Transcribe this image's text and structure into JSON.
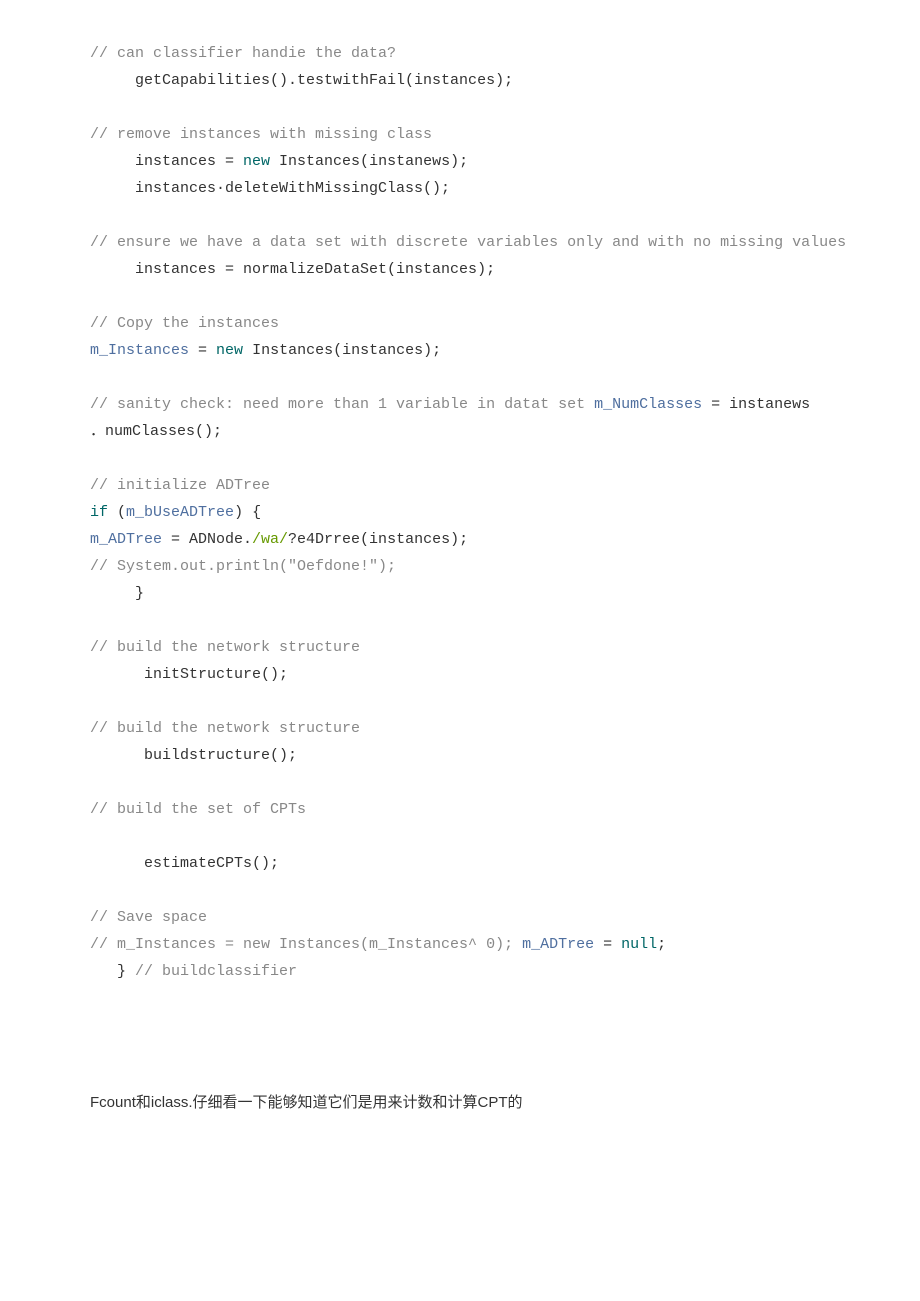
{
  "code": {
    "l1a": "// can classifier handie the data?",
    "l2a": "     getCapabilities().testwithFail(instances);",
    "l3a": "// remove instances with missing class",
    "l4a": "     instances = ",
    "l4b": "new",
    "l4c": " Instances(instanews);",
    "l5a": "     instances·deleteWithMissingClass();",
    "l6a": "// ensure we have a data set with discrete variables only and with no missing values",
    "l7a": "     instances = normalizeDataSet(instances);",
    "l8a": "// Copy the instances",
    "l9a": "m_Instances",
    "l9b": " = ",
    "l9c": "new",
    "l9d": " Instances(instances);",
    "l10a": "// sanity check: need more than 1 variable in datat set ",
    "l10b": "m_NumClasses",
    "l10c": " = instanews",
    "l10c2": "．numClasses();",
    "l11a": "// initialize ADTree",
    "l12a": "if",
    "l12b": " (",
    "l12c": "m_bUseADTree",
    "l12d": ") {",
    "l13a": "m_ADTree",
    "l13b": " = ADNode.",
    "l13c": "/wa/",
    "l13d": "?e4Drree(instances);",
    "l14a": "// System.out.println(\"Oefdone!\");",
    "l15a": "     }",
    "l16a": "// build the network structure",
    "l17a": "      initStructure();",
    "l18a": "// build the network structure",
    "l19a": "      buildstructure();",
    "l20a": "// build the set of CPTs",
    "l21a": "      estimateCPTs();",
    "l22a": "// Save space",
    "l23a": "// m_Instances = new Instances(m_Instances^ 0);",
    "l23b": " ",
    "l23c": "m_ADTree",
    "l23d": " = ",
    "l23e": "null",
    "l23f": ";",
    "l24a": "   } ",
    "l24b": "// buildclassifier"
  },
  "prose": {
    "text": "Fcount和iclass.仔细看一下能够知道它们是用来计数和计算CPT的"
  }
}
